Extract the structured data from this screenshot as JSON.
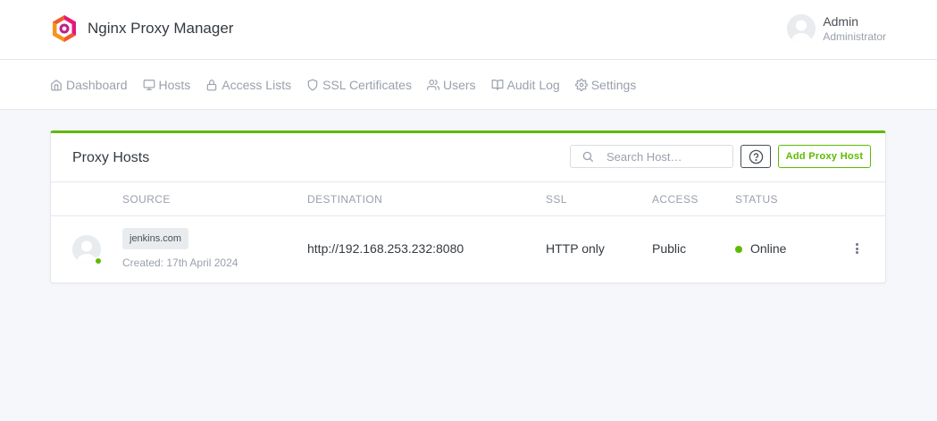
{
  "header": {
    "app_title": "Nginx Proxy Manager",
    "user_name": "Admin",
    "user_role": "Administrator"
  },
  "nav": {
    "items": [
      {
        "label": "Dashboard",
        "icon": "home-icon"
      },
      {
        "label": "Hosts",
        "icon": "monitor-icon"
      },
      {
        "label": "Access Lists",
        "icon": "lock-icon"
      },
      {
        "label": "SSL Certificates",
        "icon": "shield-icon"
      },
      {
        "label": "Users",
        "icon": "users-icon"
      },
      {
        "label": "Audit Log",
        "icon": "book-icon"
      },
      {
        "label": "Settings",
        "icon": "gear-icon"
      }
    ]
  },
  "card": {
    "title": "Proxy Hosts",
    "search_placeholder": "Search Host…",
    "add_button": "Add Proxy Host",
    "columns": [
      "Source",
      "Destination",
      "SSL",
      "Access",
      "Status"
    ],
    "rows": [
      {
        "domain": "jenkins.com",
        "created": "Created: 17th April 2024",
        "destination": "http://192.168.253.232:8080",
        "ssl": "HTTP only",
        "access": "Public",
        "status": "Online"
      }
    ]
  },
  "colors": {
    "accent": "#5eba00",
    "online": "#5eba00"
  }
}
